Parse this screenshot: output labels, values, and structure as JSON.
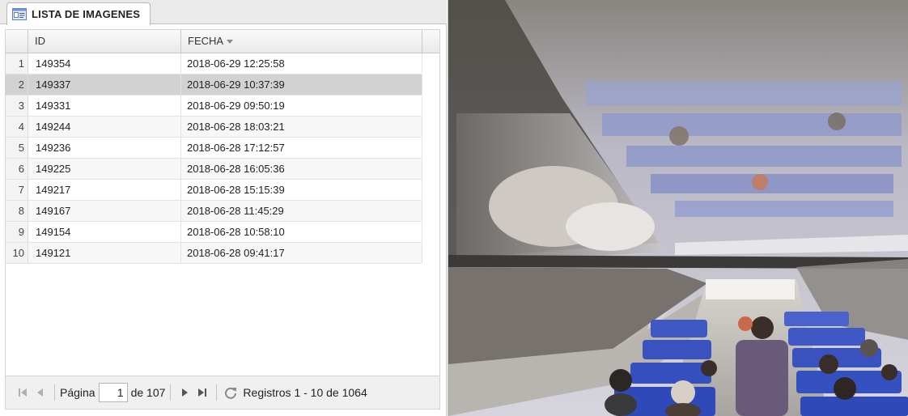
{
  "tab": {
    "title": "LISTA DE IMAGENES",
    "icon": "list-window-icon"
  },
  "grid": {
    "columns": {
      "id": "ID",
      "fecha": "FECHA"
    },
    "sort_icon": "sort-desc-icon",
    "rows": [
      {
        "num": "1",
        "id": "149354",
        "fecha": "2018-06-29 12:25:58"
      },
      {
        "num": "2",
        "id": "149337",
        "fecha": "2018-06-29 10:37:39",
        "selected": true
      },
      {
        "num": "3",
        "id": "149331",
        "fecha": "2018-06-29 09:50:19"
      },
      {
        "num": "4",
        "id": "149244",
        "fecha": "2018-06-28 18:03:21"
      },
      {
        "num": "5",
        "id": "149236",
        "fecha": "2018-06-28 17:12:57"
      },
      {
        "num": "6",
        "id": "149225",
        "fecha": "2018-06-28 16:05:36"
      },
      {
        "num": "7",
        "id": "149217",
        "fecha": "2018-06-28 15:15:39"
      },
      {
        "num": "8",
        "id": "149167",
        "fecha": "2018-06-28 11:45:29"
      },
      {
        "num": "9",
        "id": "149154",
        "fecha": "2018-06-28 10:58:10"
      },
      {
        "num": "10",
        "id": "149121",
        "fecha": "2018-06-28 09:41:17"
      }
    ]
  },
  "pager": {
    "page_label": "Página",
    "page_value": "1",
    "of_label": "de 107",
    "info": "Registros 1 - 10 de 1064",
    "icons": {
      "first": "first-page-icon",
      "prev": "prev-page-icon",
      "next": "next-page-icon",
      "last": "last-page-icon",
      "refresh": "refresh-icon"
    }
  },
  "colors": {
    "selected_row": "#d2d2d2",
    "header_bg": "#eaeaea",
    "seat_blue": "#3f58c4"
  }
}
